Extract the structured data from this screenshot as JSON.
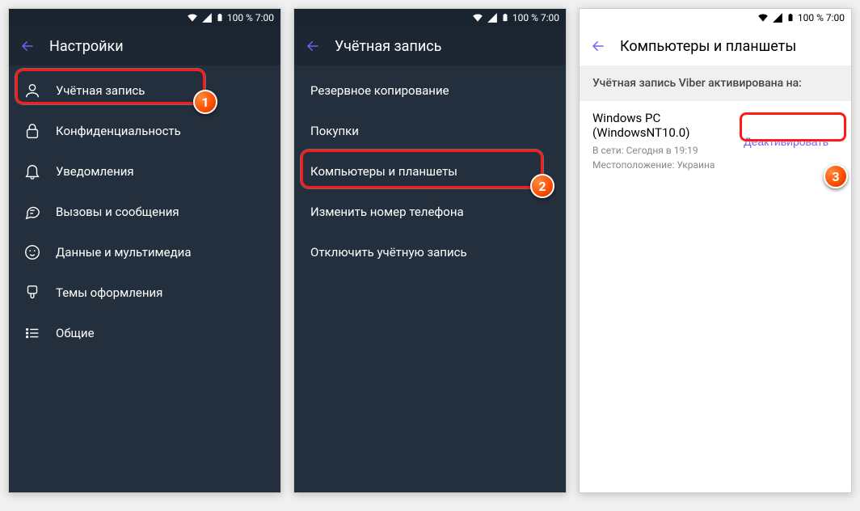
{
  "status": {
    "battery_text": "100 % 7:00"
  },
  "screen1": {
    "title": "Настройки",
    "items": [
      {
        "label": "Учётная запись"
      },
      {
        "label": "Конфиденциальность"
      },
      {
        "label": "Уведомления"
      },
      {
        "label": "Вызовы и сообщения"
      },
      {
        "label": "Данные и мультимедиа"
      },
      {
        "label": "Темы оформления"
      },
      {
        "label": "Общие"
      }
    ],
    "badge": "1"
  },
  "screen2": {
    "title": "Учётная запись",
    "items": [
      {
        "label": "Резервное копирование"
      },
      {
        "label": "Покупки"
      },
      {
        "label": "Компьютеры и планшеты"
      },
      {
        "label": "Изменить номер телефона"
      },
      {
        "label": "Отключить учётную запись"
      }
    ],
    "badge": "2"
  },
  "screen3": {
    "title": "Компьютеры и планшеты",
    "section_header": "Учётная запись Viber активирована на:",
    "device": {
      "name": "Windows PC (WindowsNT10.0)",
      "online": "В сети: Сегодня в 19:19",
      "location": "Местоположение: Украина",
      "deactivate": "Деактивировать"
    },
    "badge": "3"
  },
  "colors": {
    "accent": "#7360f2",
    "highlight": "#ff1a1a"
  }
}
